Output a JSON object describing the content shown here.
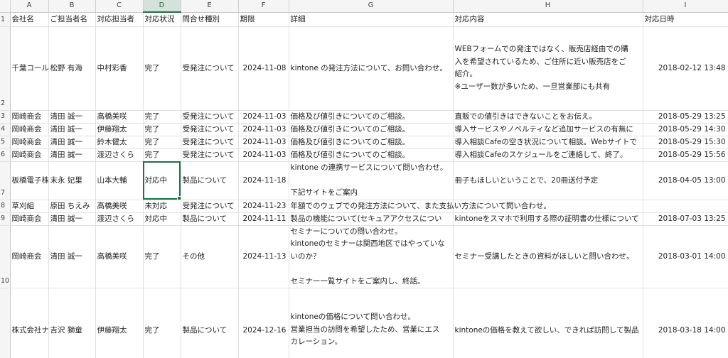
{
  "columns": [
    {
      "letter": "A"
    },
    {
      "letter": "B"
    },
    {
      "letter": "C"
    },
    {
      "letter": "D"
    },
    {
      "letter": "E"
    },
    {
      "letter": "F"
    },
    {
      "letter": "G"
    },
    {
      "letter": "H"
    },
    {
      "letter": "I"
    }
  ],
  "selected_column": "D",
  "active_cell": "D7",
  "rows": [
    {
      "num": "1",
      "cells": [
        "会社名",
        "ご担当者名",
        "対応担当者",
        "対応状況",
        "問合せ種別",
        "期限",
        "詳細",
        "対応内容",
        "対応日時"
      ]
    },
    {
      "num": "2",
      "cells": [
        "千葉コール",
        "松野 有海",
        "中村彩香",
        "完了",
        "受発注について",
        "2024-11-08",
        "kintone の発注方法について、お問い合わせ。",
        "",
        "2018-02-12 13:48"
      ],
      "h_lines": [
        "WEBフォームでの発注ではなく、販売店経由での購",
        "入を希望されているため、ご住所に近い販売店をご",
        "紹介。",
        "※ユーザー数が多いため、一旦営業部にも共有"
      ]
    },
    {
      "num": "3",
      "cells": [
        "岡崎商会",
        "清田 誠一",
        "高橋美咲",
        "完了",
        "受発注について",
        "2024-11-03",
        "価格及び値引きについてのご相談。",
        "直販での値引きはできないことをお伝え。",
        "2018-05-29 13:25"
      ]
    },
    {
      "num": "4",
      "cells": [
        "岡崎商会",
        "清田 誠一",
        "伊藤翔太",
        "完了",
        "受発注について",
        "2024-11-03",
        "価格及び値引きについてのご相談。",
        "導入サービスやノベルティなど追加サービスの有無に",
        "2018-05-29 14:30"
      ]
    },
    {
      "num": "5",
      "cells": [
        "岡崎商会",
        "清田 誠一",
        "鈴木健太",
        "完了",
        "受発注について",
        "2024-11-03",
        "価格及び値引きについてのご相談。",
        "導入相談Cafeの空き状況について相談。Webサイトで",
        "2018-05-29 15:30"
      ]
    },
    {
      "num": "6",
      "cells": [
        "岡崎商会",
        "清田 誠一",
        "渡辺さくら",
        "完了",
        "受発注について",
        "2024-11-03",
        "価格及び値引きについてのご相談。",
        "導入相談Cafeのスケジュールをご連絡して、終了。",
        "2018-05-29 15:56"
      ]
    },
    {
      "num": "7",
      "cells": [
        "板橋電子株",
        "末永 妃里",
        "山本大輔",
        "対応中",
        "製品について",
        "2024-11-18",
        "",
        "冊子もほしいということで、20冊送付予定",
        "2018-04-05 13:00"
      ],
      "g_lines": [
        "kintone の連携サービスについて問い合わせ。",
        "",
        "下記サイトをご案内"
      ]
    },
    {
      "num": "8",
      "cells": [
        "草刈組",
        "原田 ちえみ",
        "高橋美咲",
        "未対応",
        "受発注について",
        "2024-11-23",
        "年額でのウェブでの発注方法について、また支払い方法について問い合わせ。",
        "",
        ""
      ]
    },
    {
      "num": "9",
      "cells": [
        "岡崎商会",
        "清田 誠一",
        "渡辺さくら",
        "対応中",
        "製品について",
        "2024-11-11",
        "製品の機能について(セキュアアクセスについ",
        "kintoneをスマホで利用する際の証明書の仕様について",
        "2018-07-03 13:25"
      ]
    },
    {
      "num": "10",
      "cells": [
        "岡崎商会",
        "清田 誠一",
        "高橋美咲",
        "完了",
        "その他",
        "2024-11-13",
        "",
        "セミナー受講したときの資料がほしいと問い合わせ。",
        "2018-03-01 14:00"
      ],
      "g_lines": [
        "セミナーについての問い合わせ。",
        "kintoneのセミナーは関西地区ではやっていな",
        "いのか？",
        "",
        "セミナー一覧サイトをご案内し、終話。"
      ]
    },
    {
      "num": "11",
      "cells": [
        "株式会社ナ",
        "吉沢 獅童",
        "伊藤翔太",
        "完了",
        "製品について",
        "2024-12-16",
        "",
        "kintoneの価格を教えて欲しい、できれば訪問して製品",
        "2018-03-18 14:00"
      ],
      "g_lines": [
        "kintoneの価格について問い合わせ。",
        "営業担当の訪問を希望したため、営業にエス",
        "カレーション。"
      ]
    }
  ]
}
